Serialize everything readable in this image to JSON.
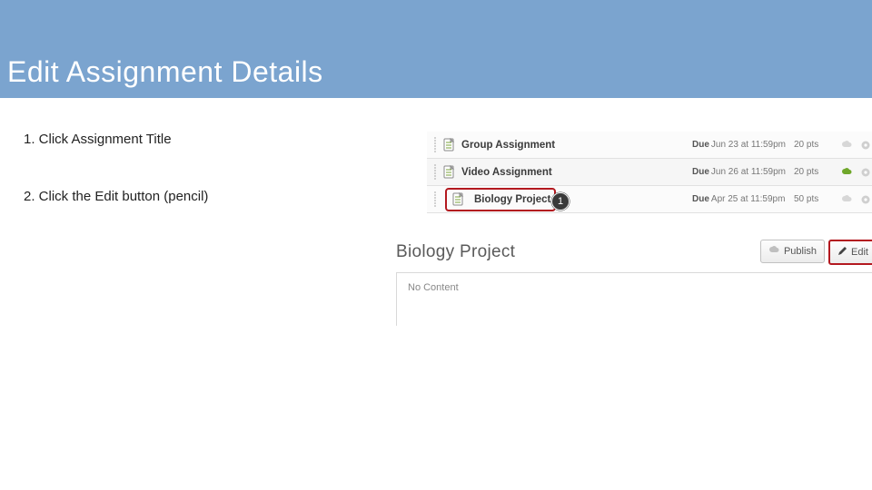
{
  "banner": {
    "title": "Edit Assignment Details"
  },
  "steps": {
    "s1": "1.   Click Assignment Title",
    "s2": "2.   Click the Edit button (pencil)"
  },
  "rows": [
    {
      "title": "Group Assignment",
      "due_label": "Due",
      "due": "Jun 23 at 11:59pm",
      "pts": "20 pts",
      "published": false
    },
    {
      "title": "Video Assignment",
      "due_label": "Due",
      "due": "Jun 26 at 11:59pm",
      "pts": "20 pts",
      "published": true
    },
    {
      "title": "Biology Project",
      "due_label": "Due",
      "due": "Apr 25 at 11:59pm",
      "pts": "50 pts",
      "published": false
    }
  ],
  "callout": {
    "n1": "1"
  },
  "detail": {
    "title": "Biology Project",
    "publish": "Publish",
    "edit": "Edit",
    "body": "No Content"
  },
  "colors": {
    "accent": "#7ba4cf",
    "highlight": "#b3181f",
    "pubGreen": "#6fa72a"
  }
}
